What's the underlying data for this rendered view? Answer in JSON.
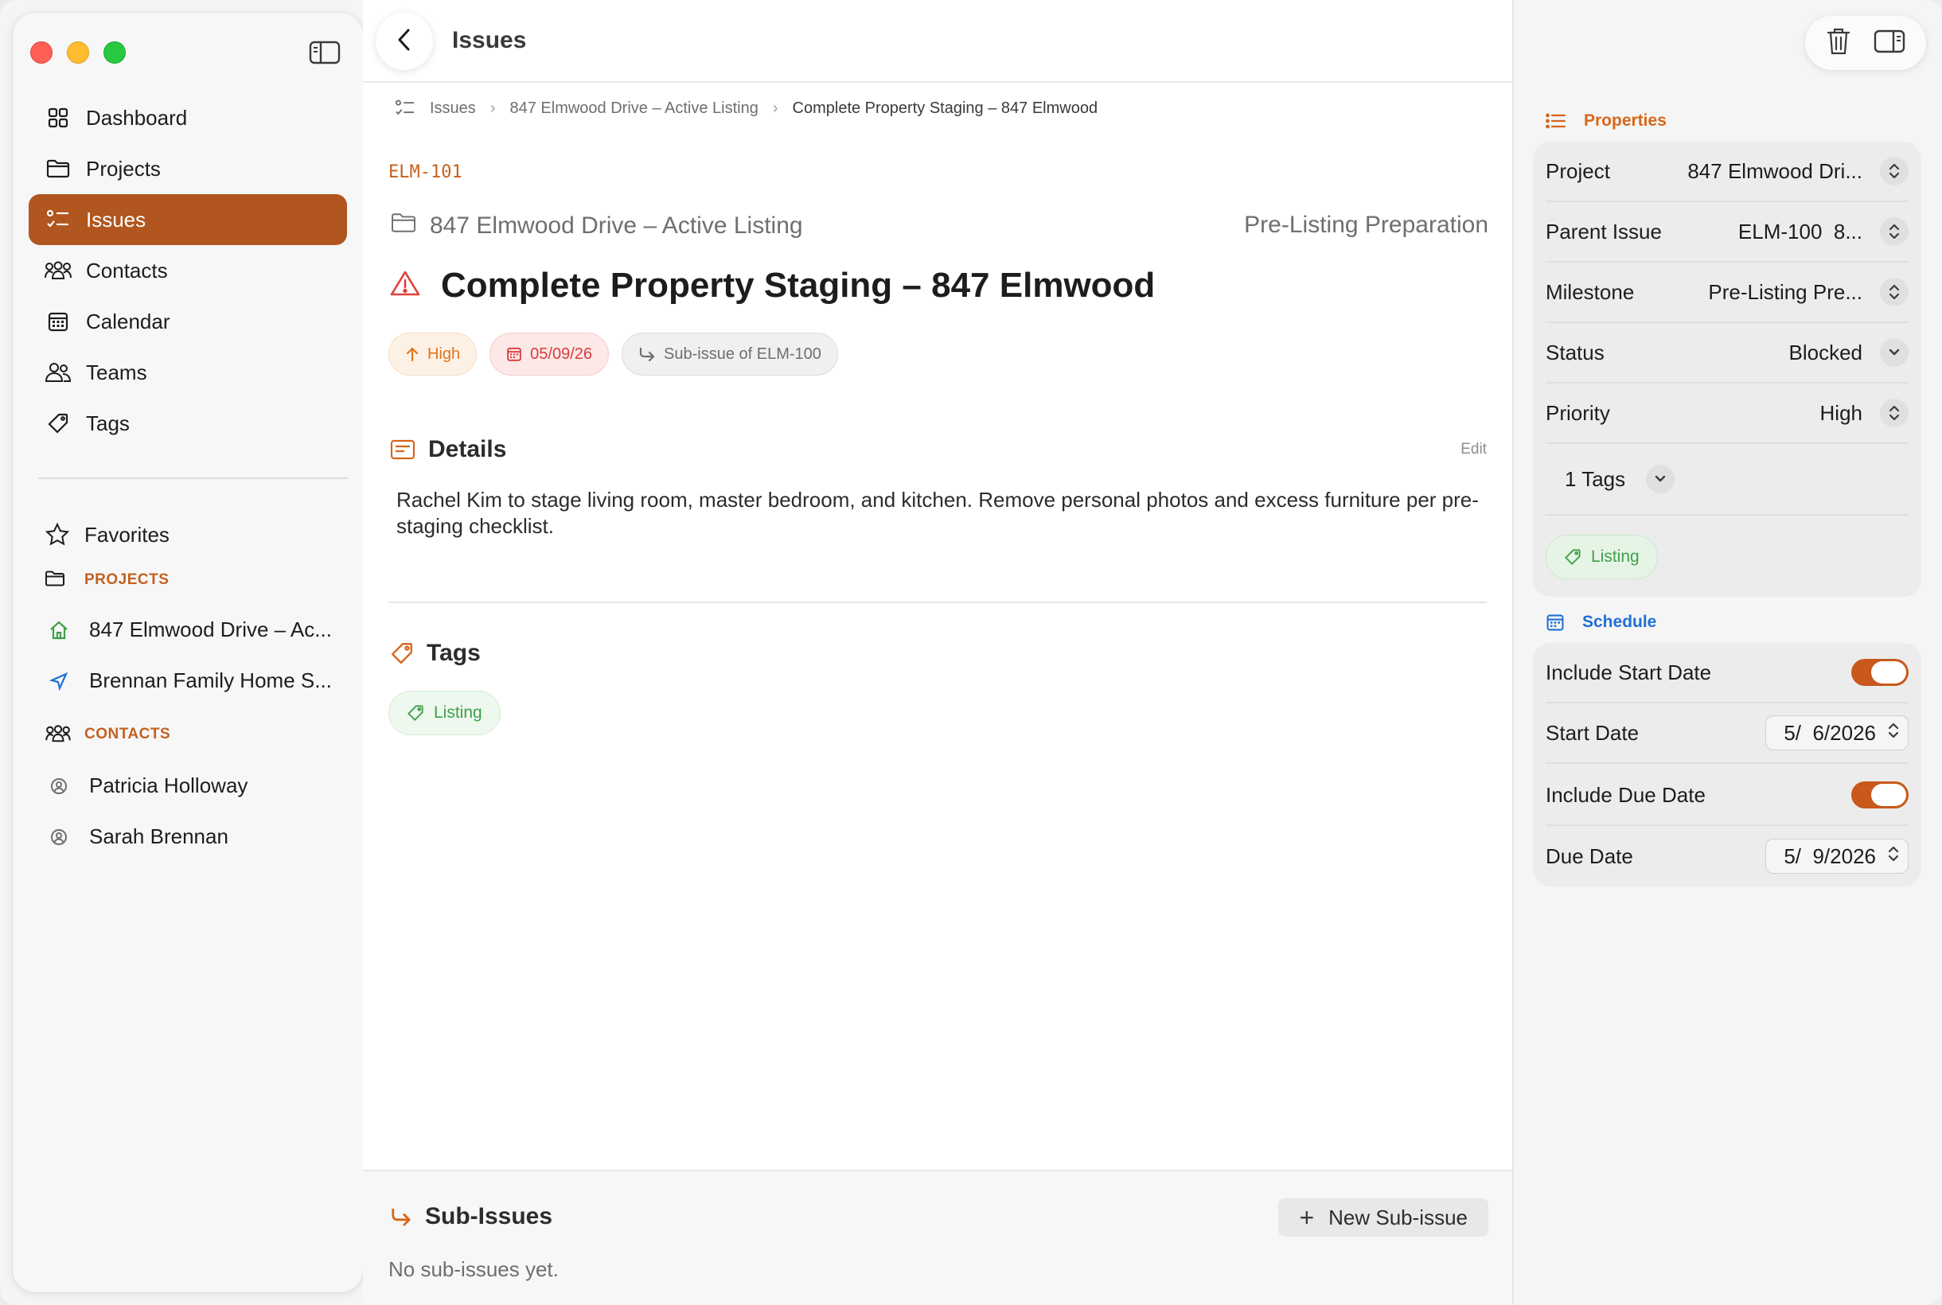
{
  "window": {
    "title": "Issues"
  },
  "sidebar": {
    "nav": [
      {
        "label": "Dashboard",
        "icon": "grid-icon"
      },
      {
        "label": "Projects",
        "icon": "folder-icon"
      },
      {
        "label": "Issues",
        "icon": "checklist-icon",
        "active": true
      },
      {
        "label": "Contacts",
        "icon": "people-group-icon"
      },
      {
        "label": "Calendar",
        "icon": "calendar-icon"
      },
      {
        "label": "Teams",
        "icon": "people-icon"
      },
      {
        "label": "Tags",
        "icon": "tag-icon"
      }
    ],
    "favorites_label": "Favorites",
    "projects_header": "PROJECTS",
    "projects": [
      {
        "label": "847 Elmwood Drive – Ac...",
        "icon": "house-icon"
      },
      {
        "label": "Brennan Family Home S...",
        "icon": "location-arrow-icon"
      }
    ],
    "contacts_header": "CONTACTS",
    "contacts": [
      {
        "label": "Patricia Holloway",
        "icon": "person-circle-icon"
      },
      {
        "label": "Sarah Brennan",
        "icon": "person-circle-icon"
      }
    ]
  },
  "breadcrumb": {
    "root": "Issues",
    "project": "847 Elmwood Drive – Active Listing",
    "current": "Complete Property Staging – 847 Elmwood"
  },
  "issue": {
    "key": "ELM-101",
    "project": "847 Elmwood Drive – Active Listing",
    "milestone": "Pre-Listing Preparation",
    "title": "Complete Property Staging – 847 Elmwood",
    "priority_chip": "High",
    "due_chip": "05/09/26",
    "parent_chip": "Sub-issue of ELM-100",
    "details_title": "Details",
    "edit_label": "Edit",
    "description": "Rachel Kim to stage living room, master bedroom, and kitchen. Remove personal photos and excess furniture per pre-staging checklist.",
    "tags_title": "Tags",
    "tags": [
      "Listing"
    ]
  },
  "subissues": {
    "title": "Sub-Issues",
    "new_label": "New Sub-issue",
    "empty_text": "No sub-issues yet."
  },
  "inspector": {
    "properties_title": "Properties",
    "rows": {
      "project": {
        "label": "Project",
        "value": "847 Elmwood Dri..."
      },
      "parent": {
        "label": "Parent Issue",
        "value": "ELM-100  8..."
      },
      "milestone": {
        "label": "Milestone",
        "value": "Pre-Listing Pre..."
      },
      "status": {
        "label": "Status",
        "value": "Blocked"
      },
      "priority": {
        "label": "Priority",
        "value": "High"
      }
    },
    "tags_count": "1 Tags",
    "tag": "Listing",
    "schedule_title": "Schedule",
    "include_start": {
      "label": "Include Start Date",
      "on": true
    },
    "start_date": {
      "label": "Start Date",
      "value": "5/  6/2026"
    },
    "include_due": {
      "label": "Include Due Date",
      "on": true
    },
    "due_date": {
      "label": "Due Date",
      "value": "5/  9/2026"
    }
  },
  "colors": {
    "accent": "#b0561e",
    "orange_text": "#c4611f",
    "schedule_blue": "#1f6fd6",
    "tag_green": "#3ea04a",
    "danger_red": "#d93b3b"
  }
}
